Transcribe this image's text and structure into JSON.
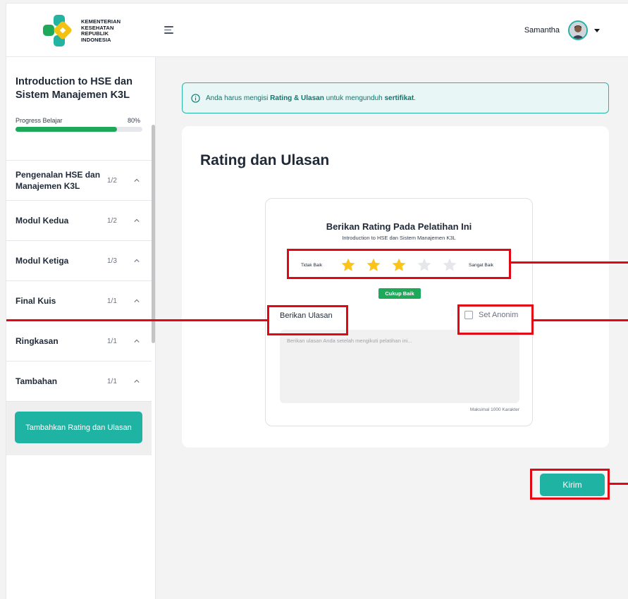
{
  "header": {
    "logo_lines": [
      "KEMENTERIAN",
      "KESEHATAN",
      "REPUBLIK",
      "INDONESIA"
    ],
    "user_name": "Samantha"
  },
  "sidebar": {
    "course_title": "Introduction to HSE dan Sistem Manajemen K3L",
    "progress_label": "Progress Belajar",
    "progress_value": "80%",
    "progress_fraction": 0.8,
    "modules": [
      {
        "name": "Pengenalan HSE dan Manajemen K3L",
        "count": "1/2"
      },
      {
        "name": "Modul Kedua",
        "count": "1/2"
      },
      {
        "name": "Modul Ketiga",
        "count": "1/3"
      },
      {
        "name": "Final Kuis",
        "count": "1/1"
      },
      {
        "name": "Ringkasan",
        "count": "1/1"
      },
      {
        "name": "Tambahan",
        "count": "1/1"
      }
    ],
    "cta_label": "Tambahkan Rating dan Ulasan"
  },
  "alert": {
    "text_before": "Anda harus mengisi ",
    "text_bold_1": "Rating & Ulasan",
    "text_middle": " untuk mengunduh ",
    "text_bold_2": "sertifikat",
    "text_end": "."
  },
  "rating_card": {
    "title": "Rating dan Ulasan",
    "heading": "Berikan Rating Pada Pelatihan Ini",
    "course_name": "Introduction to HSE dan Sistem Manajemen K3L",
    "low_label": "Tidak Baik",
    "high_label": "Sangat Baik",
    "rating_value": 3,
    "rating_max": 5,
    "rating_badge": "Cukup Baik",
    "review_label": "Berikan Ulasan",
    "anon_label": "Set Anonim",
    "anon_checked": false,
    "review_placeholder": "Berikan ulasan Anda setelah mengikuti pelatihan ini...",
    "max_chars_label": "Maksimal 1000 Karakter"
  },
  "submit_label": "Kirim",
  "colors": {
    "primary": "#1eb3a2",
    "progress": "#1ea85a",
    "star_filled": "#fcc419",
    "star_empty": "#e5e7eb",
    "annotation": "#e30613"
  }
}
